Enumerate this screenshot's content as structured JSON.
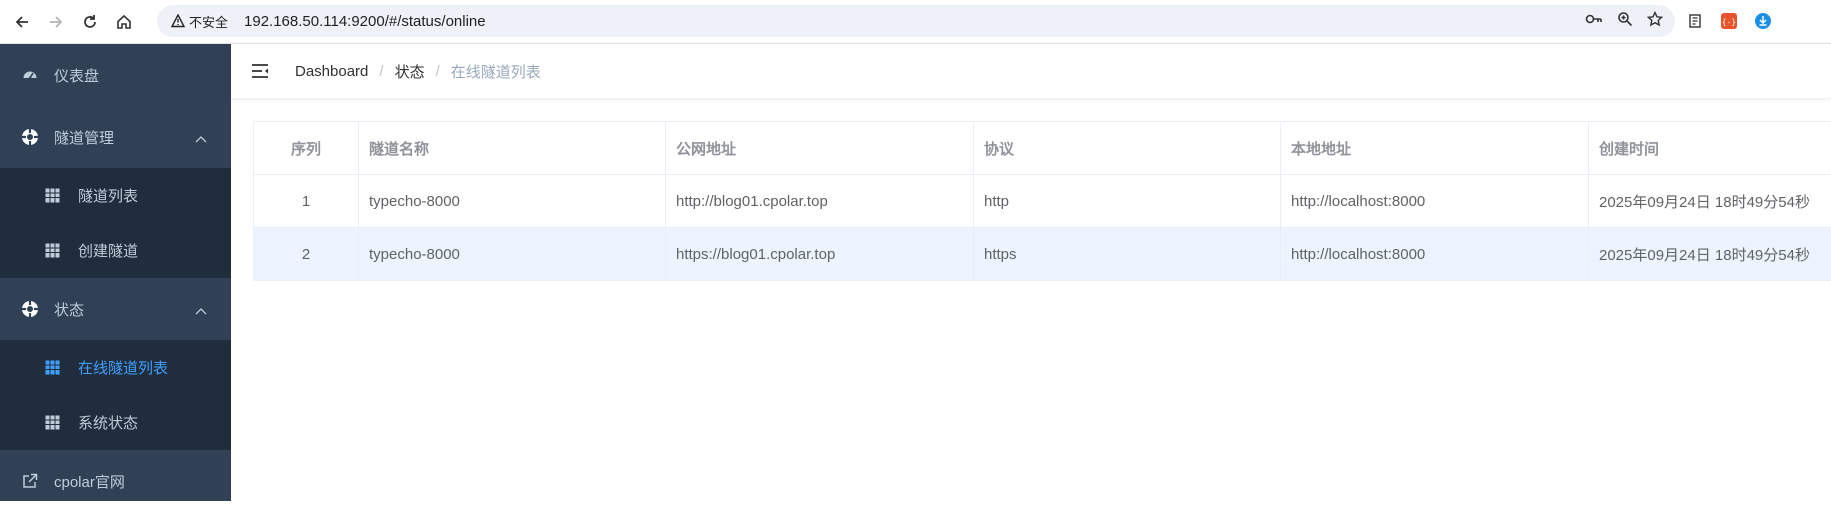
{
  "browser": {
    "security_label": "不安全",
    "url": "192.168.50.114:9200/#/status/online"
  },
  "sidebar": {
    "items": [
      {
        "label": "仪表盘",
        "icon": "dashboard-icon"
      },
      {
        "label": "隧道管理",
        "icon": "gear-icon",
        "expanded": true,
        "children": [
          {
            "label": "隧道列表",
            "icon": "table-icon"
          },
          {
            "label": "创建隧道",
            "icon": "table-icon"
          }
        ]
      },
      {
        "label": "状态",
        "icon": "gear-icon",
        "expanded": true,
        "children": [
          {
            "label": "在线隧道列表",
            "icon": "table-icon",
            "active": true
          },
          {
            "label": "系统状态",
            "icon": "table-icon"
          }
        ]
      },
      {
        "label": "cpolar官网",
        "icon": "external-link-icon"
      }
    ],
    "active_color": "#409eff",
    "bg_color": "#304156"
  },
  "breadcrumb": {
    "items": [
      "Dashboard",
      "状态"
    ],
    "current": "在线隧道列表",
    "separator": "/"
  },
  "table": {
    "columns": [
      "序列",
      "隧道名称",
      "公网地址",
      "协议",
      "本地地址",
      "创建时间"
    ],
    "rows": [
      [
        "1",
        "typecho-8000",
        "http://blog01.cpolar.top",
        "http",
        "http://localhost:8000",
        "2025年09月24日 18时49分54秒"
      ],
      [
        "2",
        "typecho-8000",
        "https://blog01.cpolar.top",
        "https",
        "http://localhost:8000",
        "2025年09月24日 18时49分54秒"
      ]
    ]
  }
}
